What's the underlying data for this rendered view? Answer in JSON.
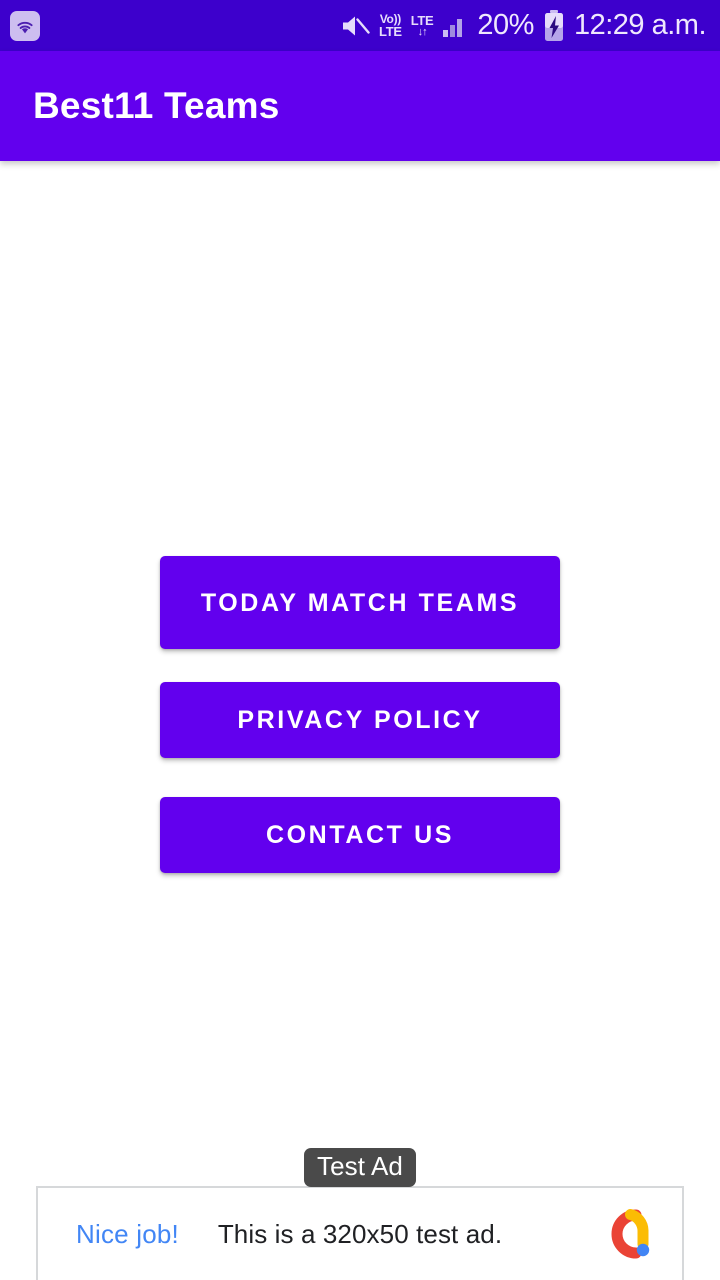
{
  "status_bar": {
    "wifi_icon": "wifi-icon",
    "mute_icon": "volume-mute-icon",
    "volte_top": "Vo))",
    "volte_bottom": "LTE",
    "lte_label": "LTE",
    "lte_arrows": "↓↑",
    "signal_icon": "cellular-signal-icon",
    "battery_percent": "20%",
    "battery_icon": "battery-charging-icon",
    "time": "12:29 a.m.",
    "background_color": "#3d00cc",
    "text_color": "#efe8fd"
  },
  "app_bar": {
    "title": "Best11 Teams",
    "background_color": "#6200ee",
    "title_color": "#ffffff"
  },
  "main": {
    "buttons": [
      {
        "label": "TODAY MATCH TEAMS",
        "name": "today-match-teams-button"
      },
      {
        "label": "PRIVACY POLICY",
        "name": "privacy-policy-button"
      },
      {
        "label": "CONTACT US",
        "name": "contact-us-button"
      }
    ],
    "button_color": "#6200ee",
    "button_text_color": "#ffffff",
    "background_color": "#ffffff"
  },
  "ad_banner": {
    "headline": "Nice job!",
    "body": "This is a 320x50 test ad.",
    "badge": "Test Ad",
    "logo_icon": "admob-logo-icon",
    "headline_color": "#4286f5",
    "body_color": "#202124",
    "badge_background": "#4a4a4a",
    "logo_colors": {
      "red": "#ea4335",
      "yellow": "#fbbc04",
      "blue": "#4285f4"
    }
  }
}
